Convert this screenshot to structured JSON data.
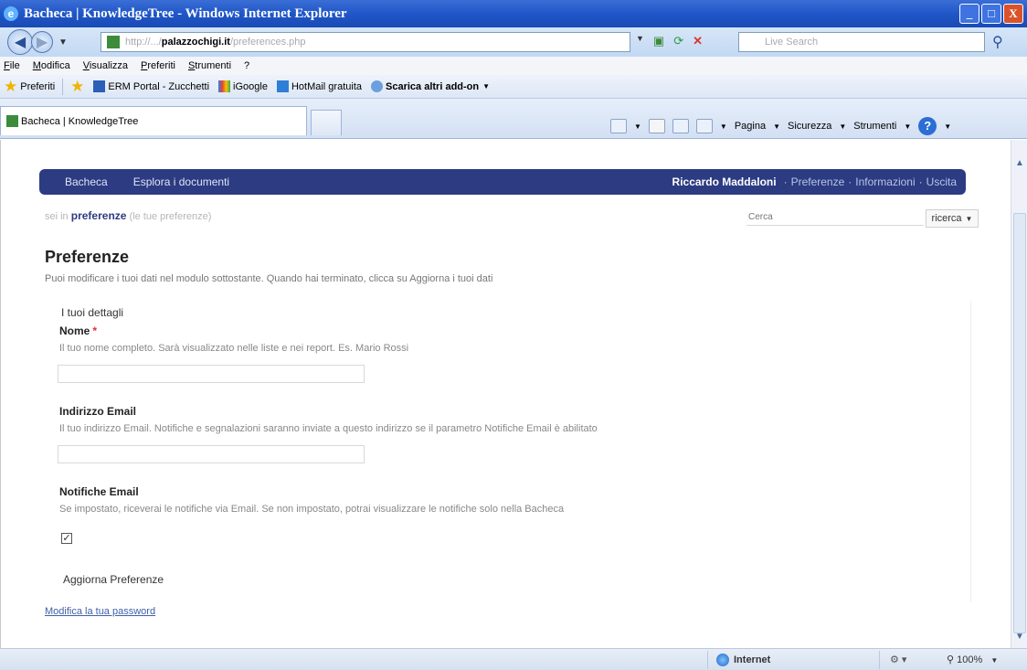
{
  "window": {
    "title": "Bacheca | KnowledgeTree - Windows Internet Explorer",
    "ie_logo": "e",
    "buttons": {
      "minimize": "_",
      "maximize": "□",
      "close": "X"
    }
  },
  "address": {
    "url_prefix": "http://.../",
    "url_host": "palazzochigi.it",
    "url_suffix": "/preferences.php",
    "search_placeholder": "Live Search"
  },
  "menu": [
    "File",
    "Modifica",
    "Visualizza",
    "Preferiti",
    "Strumenti",
    "?"
  ],
  "favorites": {
    "label": "Preferiti",
    "items": [
      "ERM Portal - Zucchetti",
      "iGoogle",
      "HotMail gratuita",
      "Scarica altri add-on"
    ]
  },
  "tab": {
    "title": "Bacheca | KnowledgeTree"
  },
  "commandbar": {
    "page": "Pagina",
    "security": "Sicurezza",
    "tools": "Strumenti",
    "help": "?"
  },
  "kt": {
    "nav_left": [
      "Bacheca",
      "Esplora i documenti"
    ],
    "user_name": "Riccardo Maddaloni",
    "user_links": [
      "Preferenze",
      "Informazioni",
      "Uscita"
    ],
    "breadcrumb_prefix": "sei in",
    "breadcrumb_current": "preferenze",
    "breadcrumb_suffix": "(le tue preferenze)",
    "search_placeholder": "Cerca",
    "search_button": "ricerca"
  },
  "page": {
    "title": "Preferenze",
    "intro": "Puoi modificare i tuoi dati nel modulo sottostante. Quando hai terminato, clicca su Aggiorna i tuoi dati",
    "legend": "I tuoi dettagli",
    "name_label": "Nome",
    "name_required": "*",
    "name_desc": "Il tuo nome completo. Sarà visualizzato nelle liste e nei report. Es. Mario Rossi",
    "email_label": "Indirizzo Email",
    "email_desc": "Il tuo indirizzo Email. Notifiche e segnalazioni saranno inviate a questo indirizzo se il parametro Notifiche Email è abilitato",
    "notify_label": "Notifiche Email",
    "notify_desc": "Se impostato, riceverai le notifiche via Email. Se non impostato, potrai visualizzare le notifiche solo nella Bacheca",
    "notify_checked": true,
    "update_button": "Aggiorna Preferenze",
    "password_link": "Modifica la tua password"
  },
  "status": {
    "zone": "Internet",
    "zoom": "100%"
  }
}
